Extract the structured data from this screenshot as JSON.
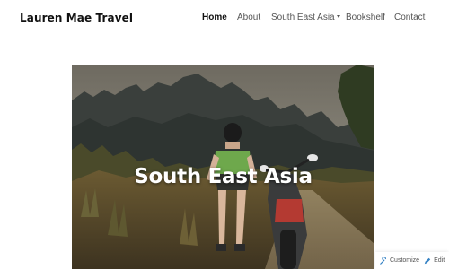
{
  "site": {
    "title": "Lauren Mae Travel"
  },
  "nav": {
    "items": [
      {
        "label": "Home",
        "active": true
      },
      {
        "label": "About"
      },
      {
        "label": "South East Asia",
        "has_submenu": true
      },
      {
        "label": "Bookshelf"
      },
      {
        "label": "Contact"
      }
    ]
  },
  "hero": {
    "title": "South East Asia",
    "image_subject": "traveler-with-motorbike-mountains"
  },
  "customize_bar": {
    "customize_label": "Customize",
    "edit_label": "Edit",
    "customize_icon": "wrench-icon",
    "edit_icon": "pencil-icon"
  },
  "colors": {
    "text_dark": "#111111",
    "nav_text": "#555555",
    "hero_text": "#ffffff"
  }
}
